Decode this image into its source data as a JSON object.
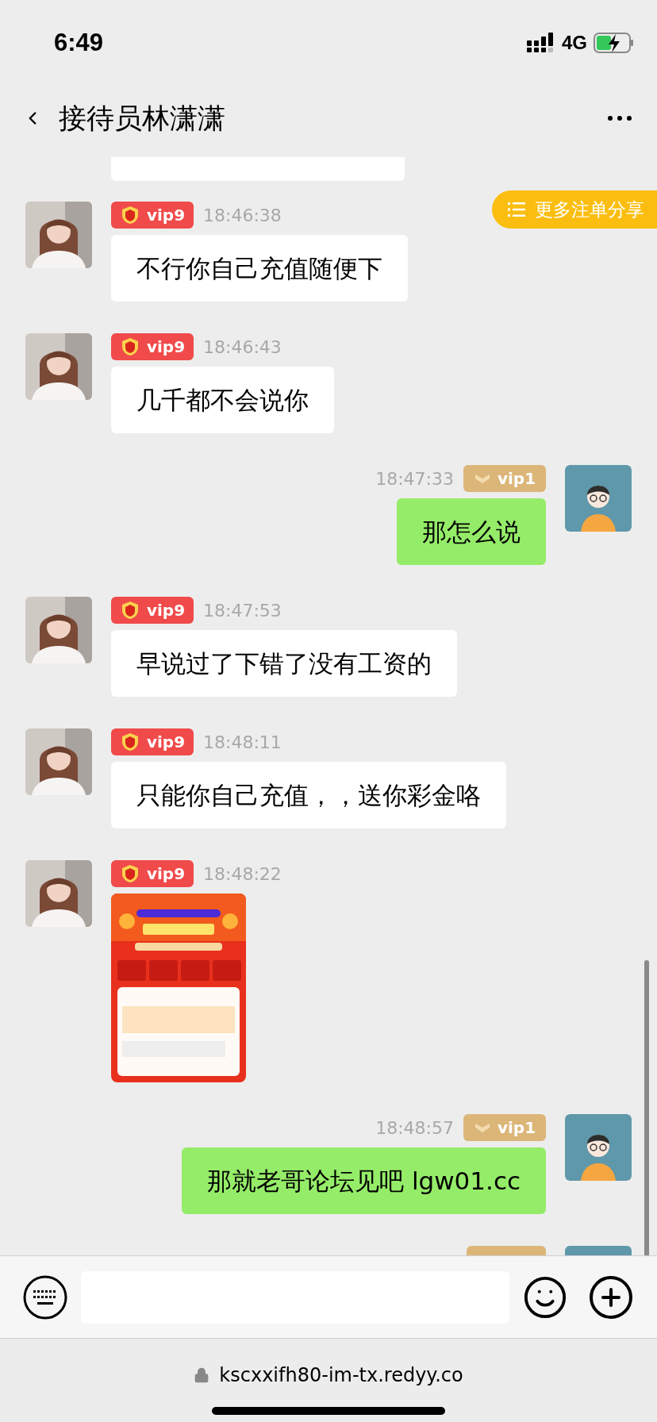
{
  "status_bar": {
    "time": "6:49",
    "network": "4G"
  },
  "header": {
    "title": "接待员林潇潇"
  },
  "share_button": {
    "label": "更多注单分享"
  },
  "messages": [
    {
      "kind": "text",
      "outgoing": false,
      "vip": "vip9",
      "color": "#f04a4a",
      "time": "18:46:38",
      "text": "不行你自己充值随便下"
    },
    {
      "kind": "text",
      "outgoing": false,
      "vip": "vip9",
      "color": "#f04a4a",
      "time": "18:46:43",
      "text": "几千都不会说你"
    },
    {
      "kind": "text",
      "outgoing": true,
      "vip": "vip1",
      "color": "#dcb679",
      "time": "18:47:33",
      "text": "那怎么说"
    },
    {
      "kind": "text",
      "outgoing": false,
      "vip": "vip9",
      "color": "#f04a4a",
      "time": "18:47:53",
      "text": "早说过了下错了没有工资的"
    },
    {
      "kind": "text",
      "outgoing": false,
      "vip": "vip9",
      "color": "#f04a4a",
      "time": "18:48:11",
      "text": "只能你自己充值，，送你彩金咯"
    },
    {
      "outgoing": false,
      "vip": "vip9",
      "color": "#f04a4a",
      "time": "18:48:22"
    },
    {
      "kind": "text",
      "outgoing": true,
      "vip": "vip1",
      "color": "#dcb679",
      "time": "18:48:57",
      "text": "那就老哥论坛见吧 lgw01.cc"
    }
  ],
  "url_bar": {
    "url": "kscxxifh80-im-tx.redyy.co"
  }
}
